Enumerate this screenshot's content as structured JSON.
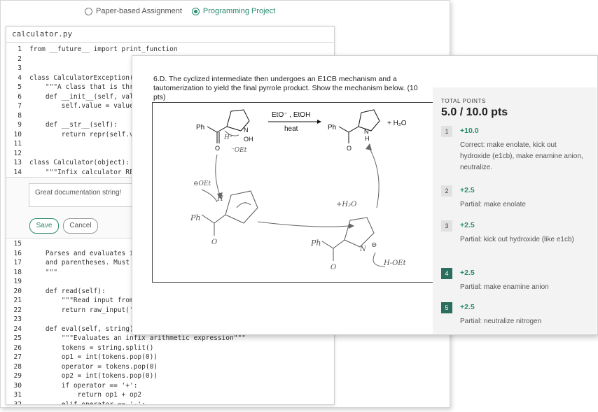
{
  "assignment_type": {
    "options": [
      "Paper-based Assignment",
      "Programming Project"
    ],
    "selected_index": 1
  },
  "code_editor": {
    "filename": "calculator.py",
    "lines_top": [
      {
        "n": "1",
        "code": "from __future__ import print_function"
      },
      {
        "n": "2",
        "code": ""
      },
      {
        "n": "3",
        "code": ""
      },
      {
        "n": "4",
        "code": "class CalculatorException(E"
      },
      {
        "n": "5",
        "code": "    \"\"\"A class that is throw"
      },
      {
        "n": "6",
        "code": "    def __init__(self, valu"
      },
      {
        "n": "7",
        "code": "        self.value = value"
      },
      {
        "n": "8",
        "code": ""
      },
      {
        "n": "9",
        "code": "    def __str__(self):"
      },
      {
        "n": "10",
        "code": "        return repr(self.va"
      },
      {
        "n": "11",
        "code": ""
      },
      {
        "n": "12",
        "code": ""
      },
      {
        "n": "13",
        "code": "class Calculator(object):"
      },
      {
        "n": "14",
        "code": "    \"\"\"Infix calculator REP"
      }
    ],
    "comment": {
      "text": "Great documentation string!",
      "save_label": "Save",
      "cancel_label": "Cancel"
    },
    "lines_bottom": [
      {
        "n": "15",
        "code": ""
      },
      {
        "n": "16",
        "code": "    Parses and evaluates in"
      },
      {
        "n": "17",
        "code": "    and parentheses. Must o"
      },
      {
        "n": "18",
        "code": "    \"\"\""
      },
      {
        "n": "19",
        "code": ""
      },
      {
        "n": "20",
        "code": "    def read(self):"
      },
      {
        "n": "21",
        "code": "        \"\"\"Read input from"
      },
      {
        "n": "22",
        "code": "        return raw_input('>"
      },
      {
        "n": "23",
        "code": ""
      },
      {
        "n": "24",
        "code": "    def eval(self, string):"
      },
      {
        "n": "25",
        "code": "        \"\"\"Evaluates an infix arithmetic expression\"\"\""
      },
      {
        "n": "26",
        "code": "        tokens = string.split()"
      },
      {
        "n": "27",
        "code": "        op1 = int(tokens.pop(0))"
      },
      {
        "n": "28",
        "code": "        operator = tokens.pop(0)"
      },
      {
        "n": "29",
        "code": "        op2 = int(tokens.pop(0))"
      },
      {
        "n": "30",
        "code": "        if operator == '+':"
      },
      {
        "n": "31",
        "code": "            return op1 + op2"
      },
      {
        "n": "32",
        "code": "        elif operator == '-':"
      }
    ]
  },
  "question": {
    "text": "6.D. The cyclized intermediate then undergoes an E1CB mechanism and a tautomerization to yield the final pyrrole product. Show the mechanism below. (10 pts)"
  },
  "scan": {
    "reagents_top": "EtO⁻ , EtOH",
    "reagents_bottom": "heat",
    "ph_left": "Ph",
    "oh": "OH",
    "n_label": "N",
    "h_label": "H",
    "ph_right": "Ph",
    "nh_n": "N",
    "nh_h": "H",
    "plus_water": "+ H₂O",
    "o_label": "O",
    "hand_notes": [
      "Hᵒ",
      "⁻OEt",
      "⊖OEt",
      "H",
      "Ph",
      "O",
      "+H₂O",
      "Ph",
      "N",
      "⊖",
      "H-OEt",
      "O"
    ]
  },
  "grading": {
    "total_label": "TOTAL POINTS",
    "total_value": "5.0 / 10.0 pts",
    "rubric": [
      {
        "num": "1",
        "points": "+10.0",
        "desc": "Correct: make enolate, kick out hydroxide (e1cb), make enamine anion, neutralize.",
        "active": false
      },
      {
        "num": "2",
        "points": "+2.5",
        "desc": "Partial: make enolate",
        "active": false
      },
      {
        "num": "3",
        "points": "+2.5",
        "desc": "Partial: kick out hydroxide (like e1cb)",
        "active": false
      },
      {
        "num": "4",
        "points": "+2.5",
        "desc": "Partial: make enamine anion",
        "active": true
      },
      {
        "num": "5",
        "points": "+2.5",
        "desc": "Partial: neutralize nitrogen",
        "active": true
      }
    ]
  },
  "colors": {
    "accent": "#2b8a6e",
    "rubric_active": "#2b6e5e",
    "panel_bg": "#f3f3f3"
  }
}
